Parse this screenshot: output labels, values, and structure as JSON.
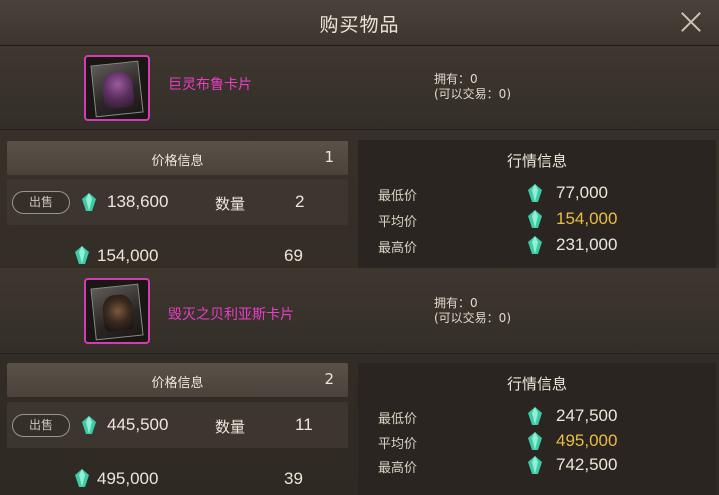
{
  "window": {
    "title": "购买物品"
  },
  "items": [
    {
      "name": "巨灵布鲁卡片",
      "own_line1": "拥有：0",
      "own_line2": "(可以交易：0)",
      "price_header": "价格信息",
      "price_header_count": "1",
      "sell_button": "出售",
      "sell_price": "138,600",
      "qty_label": "数量",
      "qty_value": "2",
      "listing_price": "154,000",
      "listing_qty": "69",
      "market_title": "行情信息",
      "min_label": "最低价",
      "min_value": "77,000",
      "avg_label": "平均价",
      "avg_value": "154,000",
      "max_label": "最高价",
      "max_value": "231,000"
    },
    {
      "name": "毁灭之贝利亚斯卡片",
      "own_line1": "拥有：0",
      "own_line2": "(可以交易：0)",
      "price_header": "价格信息",
      "price_header_count": "2",
      "sell_button": "出售",
      "sell_price": "445,500",
      "qty_label": "数量",
      "qty_value": "11",
      "listing_price": "495,000",
      "listing_qty": "39",
      "market_title": "行情信息",
      "min_label": "最低价",
      "min_value": "247,500",
      "avg_label": "平均价",
      "avg_value": "495,000",
      "max_label": "最高价",
      "max_value": "742,500"
    }
  ],
  "colors": {
    "item_name": "#e83ec8",
    "avg_price": "#e9bd45",
    "gem": "#3fc9a6",
    "card_border": "#d23cb4"
  },
  "icons": {
    "close": "close-icon",
    "currency": "gem-icon"
  }
}
